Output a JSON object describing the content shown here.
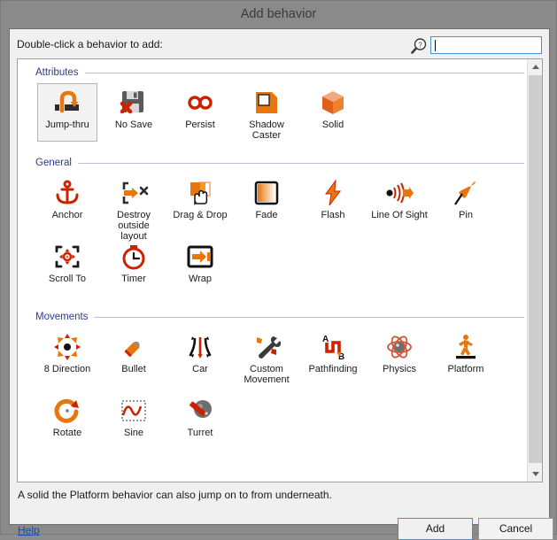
{
  "window": {
    "title": "Add behavior"
  },
  "toolbar": {
    "prompt": "Double-click a behavior to add:",
    "search_icon": "search-help-icon",
    "search_value": "",
    "search_placeholder": ""
  },
  "scrollbar": {
    "up_icon": "chevron-up-icon",
    "down_icon": "chevron-down-icon"
  },
  "sections": [
    {
      "title": "Attributes",
      "items": [
        {
          "label": "Jump-thru",
          "icon": "jump-thru-icon",
          "selected": true
        },
        {
          "label": "No Save",
          "icon": "no-save-icon",
          "selected": false
        },
        {
          "label": "Persist",
          "icon": "persist-icon",
          "selected": false
        },
        {
          "label": "Shadow Caster",
          "icon": "shadow-caster-icon",
          "selected": false
        },
        {
          "label": "Solid",
          "icon": "solid-icon",
          "selected": false
        }
      ]
    },
    {
      "title": "General",
      "items": [
        {
          "label": "Anchor",
          "icon": "anchor-icon",
          "selected": false
        },
        {
          "label": "Destroy outside layout",
          "icon": "destroy-outside-layout-icon",
          "selected": false
        },
        {
          "label": "Drag & Drop",
          "icon": "drag-and-drop-icon",
          "selected": false
        },
        {
          "label": "Fade",
          "icon": "fade-icon",
          "selected": false
        },
        {
          "label": "Flash",
          "icon": "flash-icon",
          "selected": false
        },
        {
          "label": "Line Of Sight",
          "icon": "line-of-sight-icon",
          "selected": false
        },
        {
          "label": "Pin",
          "icon": "pin-icon",
          "selected": false
        },
        {
          "label": "Scroll To",
          "icon": "scroll-to-icon",
          "selected": false
        },
        {
          "label": "Timer",
          "icon": "timer-icon",
          "selected": false
        },
        {
          "label": "Wrap",
          "icon": "wrap-icon",
          "selected": false
        }
      ]
    },
    {
      "title": "Movements",
      "items": [
        {
          "label": "8 Direction",
          "icon": "eight-direction-icon",
          "selected": false
        },
        {
          "label": "Bullet",
          "icon": "bullet-icon",
          "selected": false
        },
        {
          "label": "Car",
          "icon": "car-icon",
          "selected": false
        },
        {
          "label": "Custom Movement",
          "icon": "custom-movement-icon",
          "selected": false
        },
        {
          "label": "Pathfinding",
          "icon": "pathfinding-icon",
          "selected": false
        },
        {
          "label": "Physics",
          "icon": "physics-icon",
          "selected": false
        },
        {
          "label": "Platform",
          "icon": "platform-icon",
          "selected": false
        },
        {
          "label": "Rotate",
          "icon": "rotate-icon",
          "selected": false
        },
        {
          "label": "Sine",
          "icon": "sine-icon",
          "selected": false
        },
        {
          "label": "Turret",
          "icon": "turret-icon",
          "selected": false
        }
      ]
    }
  ],
  "footer": {
    "status": "A solid the Platform behavior can also jump on to from underneath.",
    "help_label": "Help",
    "add_label": "Add",
    "cancel_label": "Cancel"
  },
  "colors": {
    "accent_orange": "#E8760E",
    "accent_red": "#CC2200",
    "section_header": "#2B3A8F",
    "link": "#0A50B4",
    "focus_border": "#3C8EDE",
    "dialog_bg": "#F0F0F0",
    "frame": "#8A8A8A"
  }
}
